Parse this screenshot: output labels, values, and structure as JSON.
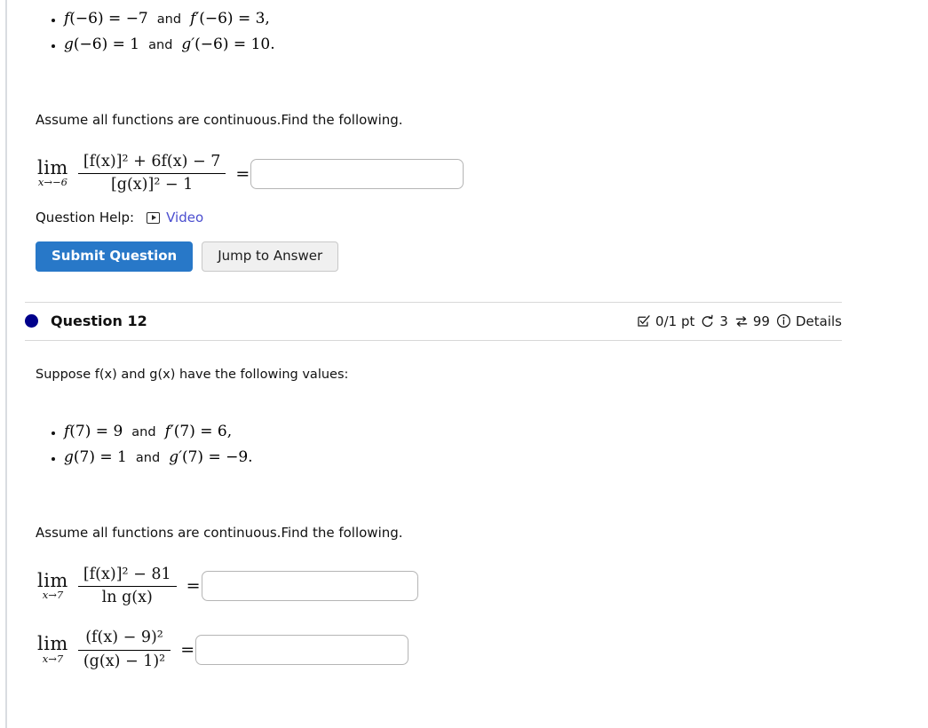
{
  "question11": {
    "given": [
      {
        "fn": "f",
        "arg": "(−6)",
        "value": "−7",
        "dfn": "f′",
        "darg": "(−6)",
        "dvalue": "3,"
      },
      {
        "fn": "g",
        "arg": "(−6)",
        "value": "1",
        "dfn": "g′",
        "darg": "(−6)",
        "dvalue": "10."
      }
    ],
    "instruction": "Assume all functions are continuous.Find the following.",
    "limits": [
      {
        "lim_op": "lim",
        "lim_sub": "x→−6",
        "numerator": "[f(x)]² + 6f(x) − 7",
        "denominator": "[g(x)]² − 1",
        "equals": "=",
        "answer_value": "",
        "answer_placeholder": ""
      }
    ],
    "help_label": "Question Help:",
    "video_link": "Video",
    "submit_label": "Submit Question",
    "jump_label": "Jump to Answer"
  },
  "question12": {
    "title": "Question 12",
    "points": "0/1 pt",
    "attempts": "3",
    "versions": "99",
    "details_label": "Details",
    "intro": "Suppose f(x) and g(x) have the following values:",
    "given": [
      {
        "fn": "f",
        "arg": "(7)",
        "value": "9",
        "dfn": "f′",
        "darg": "(7)",
        "dvalue": "6,"
      },
      {
        "fn": "g",
        "arg": "(7)",
        "value": "1",
        "dfn": "g′",
        "darg": "(7)",
        "dvalue": "−9."
      }
    ],
    "instruction": "Assume all functions are continuous.Find the following.",
    "limits": [
      {
        "lim_op": "lim",
        "lim_sub": "x→7",
        "numerator": "[f(x)]² − 81",
        "denominator": "ln g(x)",
        "equals": "=",
        "answer_value": "",
        "answer_placeholder": ""
      },
      {
        "lim_op": "lim",
        "lim_sub": "x→7",
        "numerator": "(f(x) − 9)²",
        "denominator": "(g(x) − 1)²",
        "equals": "=",
        "answer_value": "",
        "answer_placeholder": ""
      }
    ]
  },
  "colors": {
    "primary_button": "#2878c8",
    "link": "#4b4ecf",
    "status_dot": "#00008b",
    "divider": "#d8d8d8"
  },
  "icons": {
    "checkbox_check": "checkbox-check-icon",
    "rotate_left": "rotate-left-icon",
    "exchange": "exchange-icon",
    "info": "info-circle-icon",
    "video_play": "video-play-icon"
  }
}
